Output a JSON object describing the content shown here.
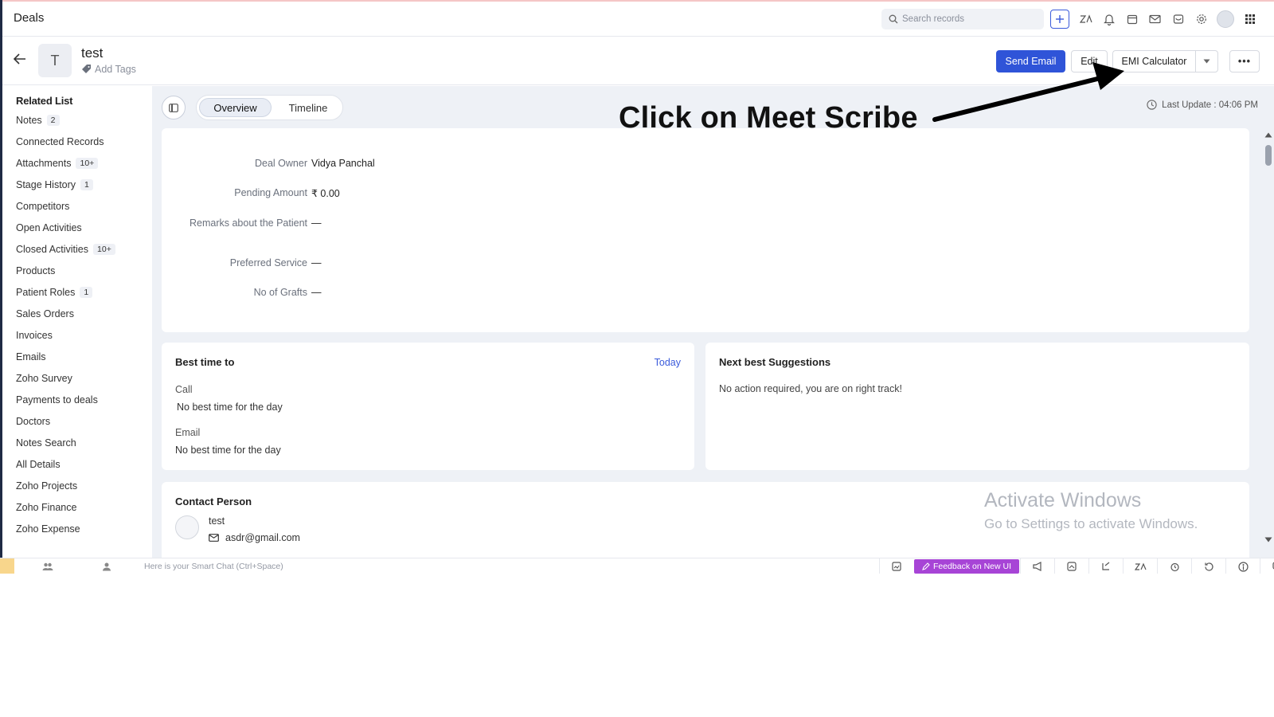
{
  "topbar": {
    "module_title": "Deals",
    "search_placeholder": "Search records"
  },
  "record": {
    "avatar_letter": "T",
    "name": "test",
    "add_tags": "Add Tags",
    "buttons": {
      "send_email": "Send Email",
      "edit": "Edit",
      "emi_calculator": "EMI Calculator",
      "more": "•••"
    }
  },
  "sidebar": {
    "title": "Related List",
    "items": [
      {
        "label": "Notes",
        "badge": "2"
      },
      {
        "label": "Connected Records",
        "badge": ""
      },
      {
        "label": "Attachments",
        "badge": "10+"
      },
      {
        "label": "Stage History",
        "badge": "1"
      },
      {
        "label": "Competitors",
        "badge": ""
      },
      {
        "label": "Open Activities",
        "badge": ""
      },
      {
        "label": "Closed Activities",
        "badge": "10+"
      },
      {
        "label": "Products",
        "badge": ""
      },
      {
        "label": "Patient Roles",
        "badge": "1"
      },
      {
        "label": "Sales Orders",
        "badge": ""
      },
      {
        "label": "Invoices",
        "badge": ""
      },
      {
        "label": "Emails",
        "badge": ""
      },
      {
        "label": "Zoho Survey",
        "badge": ""
      },
      {
        "label": "Payments to deals",
        "badge": ""
      },
      {
        "label": "Doctors",
        "badge": ""
      },
      {
        "label": "Notes Search",
        "badge": ""
      },
      {
        "label": "All Details",
        "badge": ""
      },
      {
        "label": "Zoho Projects",
        "badge": ""
      },
      {
        "label": "Zoho Finance",
        "badge": ""
      },
      {
        "label": "Zoho Expense",
        "badge": ""
      }
    ]
  },
  "tabs": {
    "overview": "Overview",
    "timeline": "Timeline"
  },
  "last_update": "Last Update : 04:06 PM",
  "details": {
    "fields": [
      {
        "label": "Deal Owner",
        "value": "Vidya Panchal"
      },
      {
        "label": "Pending Amount",
        "value": "₹ 0.00"
      },
      {
        "label": "Remarks about the Patient",
        "value": "—"
      },
      {
        "label": "Preferred Service",
        "value": "—"
      },
      {
        "label": "No of Grafts",
        "value": "—"
      }
    ]
  },
  "best_time": {
    "title": "Best time to",
    "link": "Today",
    "call_label": "Call",
    "call_value": "No best time for the day",
    "email_label": "Email",
    "email_value": "No best time for the day"
  },
  "next_best": {
    "title": "Next best Suggestions",
    "message": "No action required, you are on right track!"
  },
  "contact": {
    "title": "Contact Person",
    "name": "test",
    "email": "asdr@gmail.com"
  },
  "watermark": {
    "line1": "Activate Windows",
    "line2": "Go to Settings to activate Windows."
  },
  "annotation": {
    "text": "Click on Meet Scribe"
  },
  "bottombar": {
    "smart_chat": "Here is your Smart Chat (Ctrl+Space)",
    "feedback": "Feedback on New UI"
  },
  "colors": {
    "primary": "#2f54d8",
    "feedback": "#a744d6",
    "canvas": "#eef1f6"
  }
}
